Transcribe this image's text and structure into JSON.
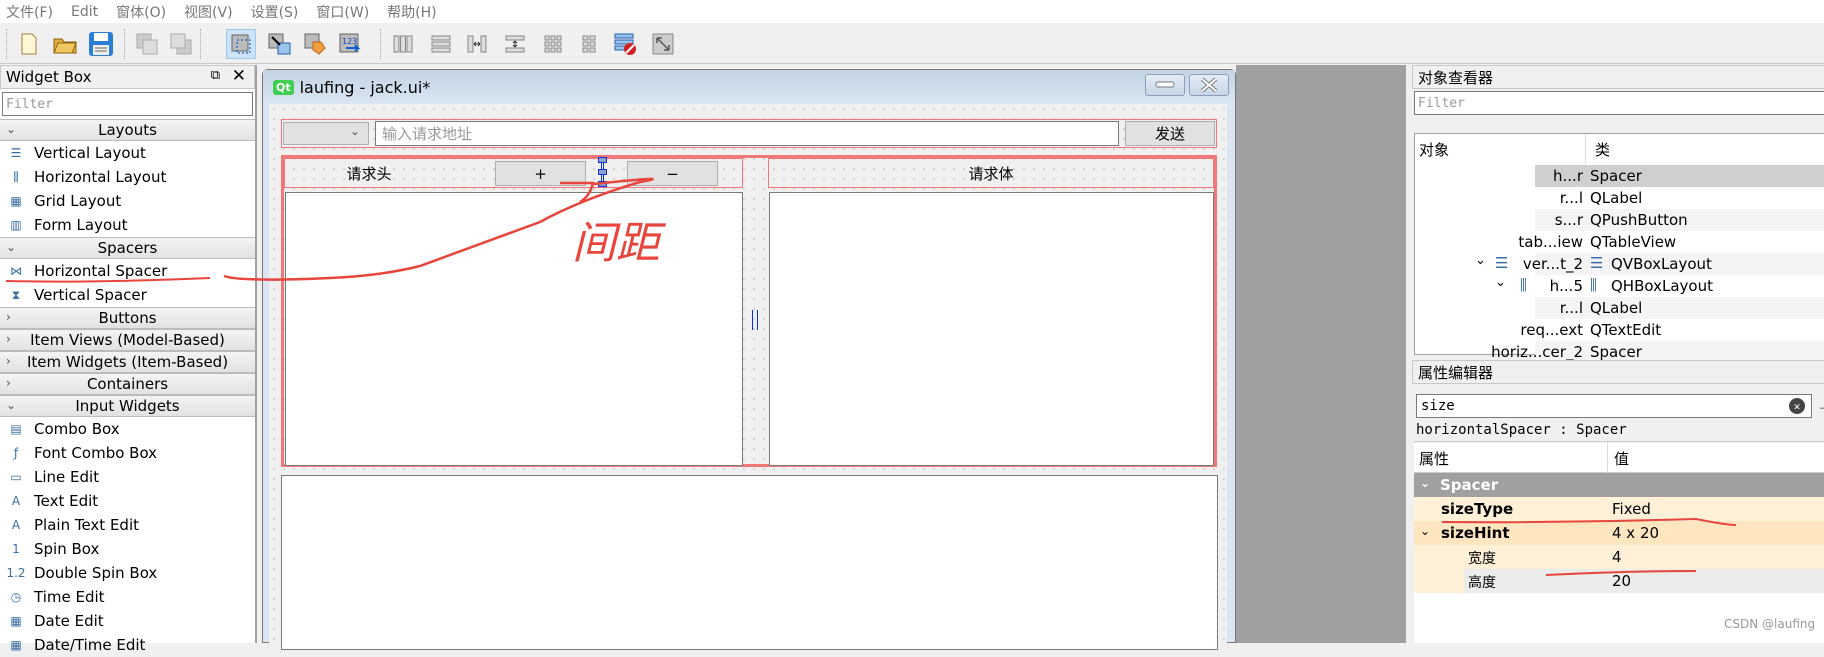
{
  "menu": [
    "文件(F)",
    "Edit",
    "窗体(O)",
    "视图(V)",
    "设置(S)",
    "窗口(W)",
    "帮助(H)"
  ],
  "toolbar": {
    "icons": [
      "new-file-icon",
      "open-folder-icon",
      "save-icon",
      "bring-to-front-icon",
      "send-to-back-icon",
      "edit-widgets-icon",
      "edit-signals-slots-icon",
      "edit-buddies-icon",
      "edit-tab-order-icon",
      "layout-horizontal-icon",
      "layout-vertical-icon",
      "layout-h-splitter-icon",
      "layout-v-splitter-icon",
      "layout-grid-icon",
      "layout-form-icon",
      "break-layout-icon",
      "adjust-size-icon"
    ]
  },
  "widget_box": {
    "title": "Widget Box",
    "filter_placeholder": "Filter",
    "categories": [
      {
        "label": "Layouts",
        "expanded": true,
        "items": [
          "Vertical Layout",
          "Horizontal Layout",
          "Grid Layout",
          "Form Layout"
        ]
      },
      {
        "label": "Spacers",
        "expanded": true,
        "items": [
          "Horizontal Spacer",
          "Vertical Spacer"
        ]
      },
      {
        "label": "Buttons",
        "expanded": false,
        "items": []
      },
      {
        "label": "Item Views (Model-Based)",
        "expanded": false,
        "items": []
      },
      {
        "label": "Item Widgets (Item-Based)",
        "expanded": false,
        "items": []
      },
      {
        "label": "Containers",
        "expanded": false,
        "items": []
      },
      {
        "label": "Input Widgets",
        "expanded": true,
        "items": [
          "Combo Box",
          "Font Combo Box",
          "Line Edit",
          "Text Edit",
          "Plain Text Edit",
          "Spin Box",
          "Double Spin Box",
          "Time Edit",
          "Date Edit",
          "Date/Time Edit"
        ]
      }
    ]
  },
  "form": {
    "title": "laufing - jack.ui*",
    "url_placeholder": "输入请求地址",
    "send_label": "发送",
    "header_label": "请求头",
    "plus_label": "+",
    "minus_label": "−",
    "body_label": "请求体"
  },
  "annotation": {
    "text": "间距",
    "color": "#e8453c"
  },
  "object_inspector": {
    "title": "对象查看器",
    "filter_placeholder": "Filter",
    "col_object": "对象",
    "col_class": "类",
    "rows": [
      {
        "name": "h...r",
        "cls": "Spacer",
        "selected": true
      },
      {
        "name": "r...l",
        "cls": "QLabel"
      },
      {
        "name": "s...r",
        "cls": "QPushButton"
      },
      {
        "name": "tab...iew",
        "cls": "QTableView"
      },
      {
        "name": "ver...t_2",
        "cls": "QVBoxLayout",
        "expander": true
      },
      {
        "name": "h...5",
        "cls": "QHBoxLayout",
        "expander": true
      },
      {
        "name": "r...l",
        "cls": "QLabel"
      },
      {
        "name": "req...ext",
        "cls": "QTextEdit"
      },
      {
        "name": "horiz...cer_2",
        "cls": "Spacer"
      }
    ]
  },
  "property_editor": {
    "title": "属性编辑器",
    "filter_value": "size",
    "object_label": "horizontalSpacer : Spacer",
    "col_property": "属性",
    "col_value": "值",
    "group": "Spacer",
    "props": [
      {
        "key": "sizeType",
        "value": "Fixed"
      },
      {
        "key": "sizeHint",
        "value": "4 x 20"
      },
      {
        "key": "宽度",
        "value": "4"
      },
      {
        "key": "高度",
        "value": "20"
      }
    ]
  },
  "watermark": "CSDN @laufing"
}
